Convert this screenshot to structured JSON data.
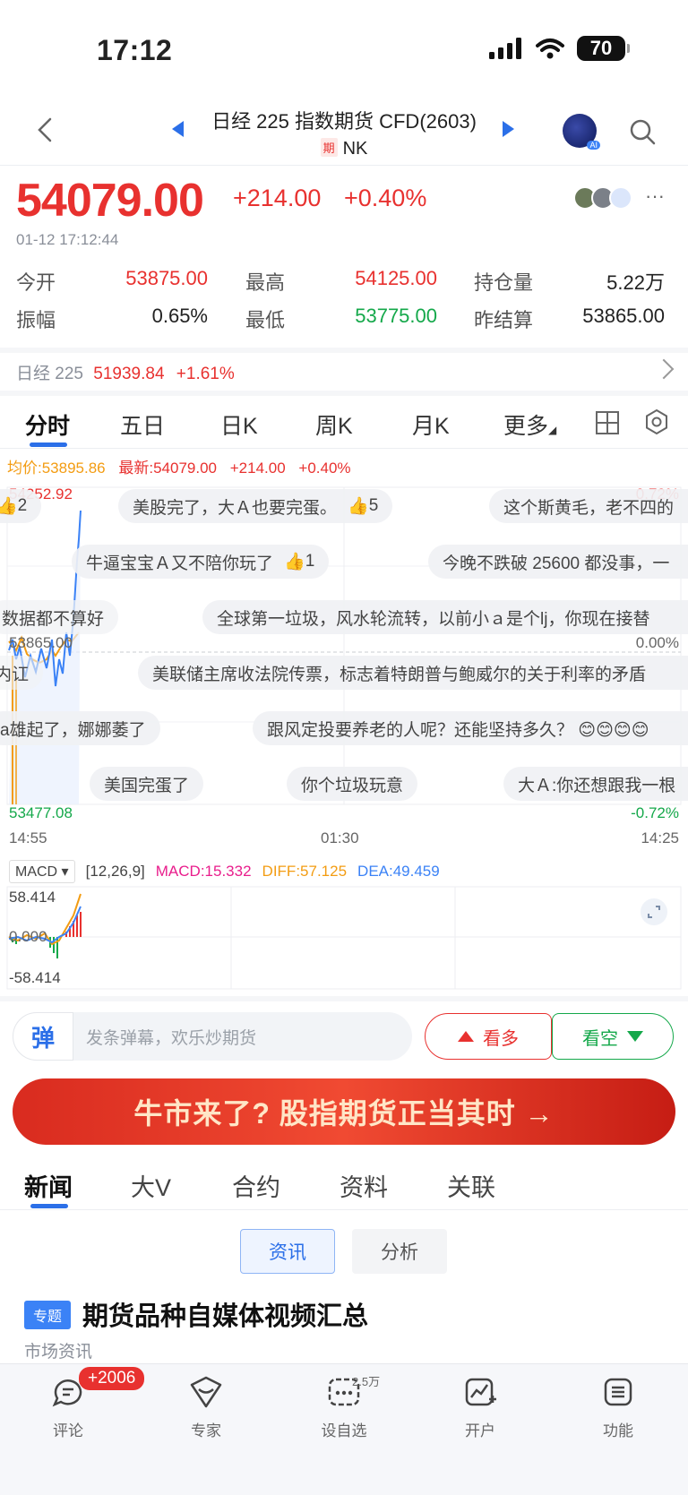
{
  "status": {
    "time": "17:12",
    "battery": "70"
  },
  "header": {
    "title": "日经 225 指数期货 CFD(2603)",
    "badge": "期",
    "code": "NK"
  },
  "quote": {
    "price": "54079.00",
    "change": "+214.00",
    "change_pct": "+0.40%",
    "timestamp": "01-12 17:12:44",
    "more": "···"
  },
  "stats": [
    {
      "label": "今开",
      "value": "53875.00",
      "color": "red"
    },
    {
      "label": "最高",
      "value": "54125.00",
      "color": "red"
    },
    {
      "label": "持仓量",
      "value": "5.22万",
      "color": "dark"
    },
    {
      "label": "振幅",
      "value": "0.65%",
      "color": "dark"
    },
    {
      "label": "最低",
      "value": "53775.00",
      "color": "green"
    },
    {
      "label": "昨结算",
      "value": "53865.00",
      "color": "dark"
    }
  ],
  "index_row": {
    "name": "日经 225",
    "value": "51939.84",
    "pct": "+1.61%"
  },
  "chart_tabs": [
    "分时",
    "五日",
    "日K",
    "周K",
    "月K",
    "更多"
  ],
  "legend": {
    "avg": "均价:53895.86",
    "latest": "最新:54079.00",
    "change": "+214.00",
    "pct": "+0.40%"
  },
  "chart": {
    "y_max_label": "54252.92",
    "y_mid_label": "53865.00",
    "y_min_label": "53477.08",
    "pct_max": "0.72%",
    "pct_mid": "0.00%",
    "pct_min": "-0.72%",
    "x_labels": [
      "14:55",
      "01:30",
      "14:25"
    ]
  },
  "danmu": [
    {
      "text": "2",
      "like": ""
    },
    {
      "text": "美股完了，大Ａ也要完蛋。",
      "like": "5"
    },
    {
      "text": "这个斯黄毛，老不四的",
      "like": ""
    },
    {
      "text": "牛逼宝宝Ａ又不陪你玩了",
      "like": "1"
    },
    {
      "text": "今晚不跌破 25600 都没事，一",
      "like": ""
    },
    {
      "text": "数据都不算好",
      "like": ""
    },
    {
      "text": "全球第一垃圾，风水轮流转，以前小ａ是个lj，你现在接替",
      "like": ""
    },
    {
      "text": "内讧",
      "like": ""
    },
    {
      "text": "美联储主席收法院传票，标志着特朗普与鲍威尔的关于利率的矛盾",
      "like": ""
    },
    {
      "text": "a雄起了，娜娜萎了",
      "like": ""
    },
    {
      "text": "跟风定投要养老的人呢？还能坚持多久？ 😊😊😊😊",
      "like": ""
    },
    {
      "text": "美国完蛋了",
      "like": ""
    },
    {
      "text": "你个垃圾玩意",
      "like": ""
    },
    {
      "text": "大Ａ:你还想跟我一根",
      "like": ""
    }
  ],
  "macd": {
    "selector": "MACD",
    "params": "[12,26,9]",
    "macd": "MACD:15.332",
    "diff": "DIFF:57.125",
    "dea": "DEA:49.459",
    "max": "58.414",
    "zero": "0.000",
    "min": "-58.414"
  },
  "input": {
    "logo": "弹",
    "placeholder": "发条弹幕，欢乐炒期货"
  },
  "buttons": {
    "bull": "看多",
    "bear": "看空"
  },
  "banner": {
    "text": "牛市来了? 股指期货正当其时 →"
  },
  "news_tabs": [
    "新闻",
    "大V",
    "合约",
    "资料",
    "关联"
  ],
  "segments": [
    "资讯",
    "分析"
  ],
  "topic": {
    "badge": "专题",
    "title": "期货品种自媒体视频汇总",
    "source": "市场资讯"
  },
  "bottom_nav": [
    {
      "label": "评论",
      "icon": "comment-icon"
    },
    {
      "label": "专家",
      "icon": "expert-icon"
    },
    {
      "label": "设自选",
      "icon": "watchlist-icon"
    },
    {
      "label": "开户",
      "icon": "open-account-icon"
    },
    {
      "label": "功能",
      "icon": "function-icon"
    }
  ],
  "comment_badge": "+2006",
  "watch_count": "2.5万",
  "colors": {
    "up": "#e8312f",
    "down": "#14a84a",
    "accent": "#2b6fe8",
    "avg_line": "#f39c12"
  }
}
